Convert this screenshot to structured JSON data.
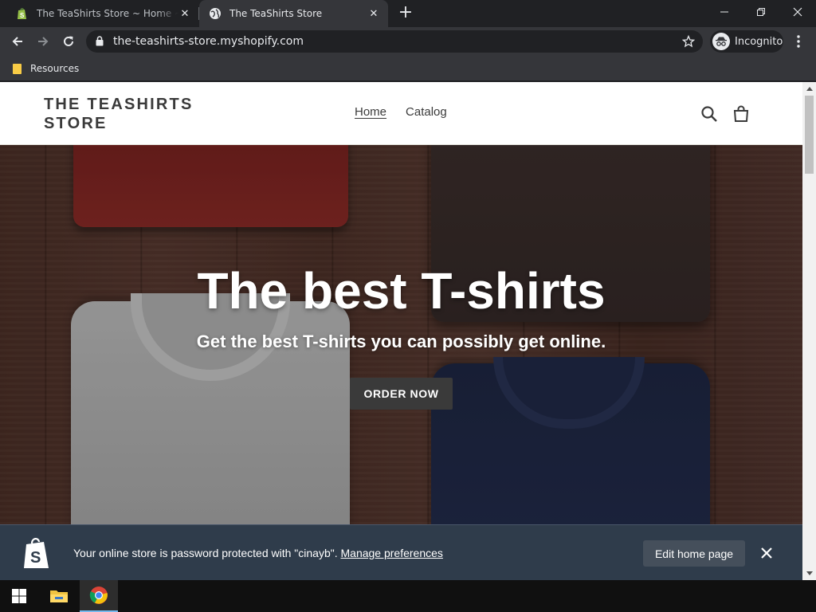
{
  "browser": {
    "tabs": [
      {
        "title": "The TeaShirts Store ~ Home ~ Shopify",
        "favicon": "shopify-icon",
        "active": false
      },
      {
        "title": "The TeaShirts Store",
        "favicon": "globe-icon",
        "active": true
      }
    ],
    "url": "the-teashirts-store.myshopify.com",
    "profile_label": "Incognito",
    "bookmarks": [
      {
        "label": "Resources",
        "icon": "folder-icon"
      }
    ]
  },
  "site": {
    "logo": "THE TEASHIRTS STORE",
    "nav": [
      {
        "label": "Home",
        "active": true
      },
      {
        "label": "Catalog",
        "active": false
      }
    ],
    "hero": {
      "title": "The best T-shirts",
      "subtitle": "Get the best T-shirts you can possibly get online.",
      "button": "ORDER NOW"
    }
  },
  "admin_bar": {
    "message": "Your online store is password protected with \"cinayb\".",
    "link": "Manage preferences",
    "button": "Edit home page"
  },
  "colors": {
    "browser_frame": "#202124",
    "toolbar": "#35363a",
    "admin_bar": "#2f3c4b",
    "hero_button": "#3a3a3a",
    "text_dark": "#3a3a3a"
  }
}
